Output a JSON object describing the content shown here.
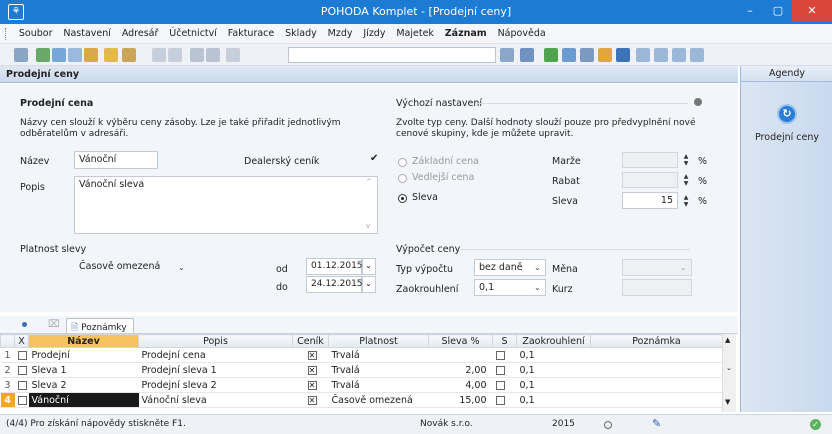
{
  "window": {
    "title": "POHODA Komplet - [Prodejní ceny]",
    "app_icon": "app-icon"
  },
  "menu": [
    "Soubor",
    "Nastavení",
    "Adresář",
    "Účetnictví",
    "Fakturace",
    "Sklady",
    "Mzdy",
    "Jízdy",
    "Majetek",
    "Záznam",
    "Nápověda"
  ],
  "agenda_title": "Prodejní ceny",
  "right_panel": {
    "header": "Agendy",
    "item": "Prodejní ceny"
  },
  "form": {
    "section_title": "Prodejní cena",
    "description": "Názvy cen slouží k výběru ceny zásoby. Lze je také přiřadit jednotlivým odběratelům v adresáři.",
    "name_label": "Název",
    "name_value": "Vánoční",
    "dealer_label": "Dealerský ceník",
    "dealer_checked": "✔",
    "desc_label": "Popis",
    "desc_value": "Vánoční sleva",
    "validity_label": "Platnost slevy",
    "validity_value": "Časově omezená",
    "from_label": "od",
    "from_value": "01.12.2015",
    "to_label": "do",
    "to_value": "24.12.2015",
    "defaults_title": "Výchozí nastavení",
    "defaults_desc": "Zvolte typ ceny. Další hodnoty slouží pouze pro předvyplnění nové cenové skupiny, kde je můžete upravit.",
    "radio_basic": "Základní cena",
    "radio_secondary": "Vedlejší cena",
    "radio_discount": "Sleva",
    "margin_label": "Marže",
    "rebate_label": "Rabat",
    "discount_label": "Sleva",
    "discount_value": "15",
    "percent": "%",
    "calc_title": "Výpočet ceny",
    "calc_type_label": "Typ výpočtu",
    "calc_type_value": "bez daně",
    "currency_label": "Měna",
    "rounding_label": "Zaokrouhlení",
    "rounding_value": "0,1",
    "rate_label": "Kurz"
  },
  "tabs": {
    "notes": "Poznámky"
  },
  "grid": {
    "columns": [
      "X",
      "Název",
      "Popis",
      "Ceník",
      "Platnost",
      "Sleva %",
      "S",
      "Zaokrouhlení",
      "Poznámka"
    ],
    "rows": [
      {
        "n": "1",
        "name": "Prodejní",
        "desc": "Prodejní cena",
        "validity": "Trvalá",
        "discount": "",
        "rounding": "0,1"
      },
      {
        "n": "2",
        "name": "Sleva 1",
        "desc": "Prodejní sleva 1",
        "validity": "Trvalá",
        "discount": "2,00",
        "rounding": "0,1"
      },
      {
        "n": "3",
        "name": "Sleva 2",
        "desc": "Prodejní sleva 2",
        "validity": "Trvalá",
        "discount": "4,00",
        "rounding": "0,1"
      },
      {
        "n": "4",
        "name": "Vánoční",
        "desc": "Vánoční sleva",
        "validity": "Časově omezená",
        "discount": "15,00",
        "rounding": "0,1"
      }
    ]
  },
  "status": {
    "help": "(4/4) Pro získání nápovědy stiskněte F1.",
    "company": "Novák s.r.o.",
    "year": "2015"
  },
  "colors": {
    "titlebar": "#1e7bd3",
    "selected_row": "#f5a623",
    "close": "#d9463a"
  }
}
